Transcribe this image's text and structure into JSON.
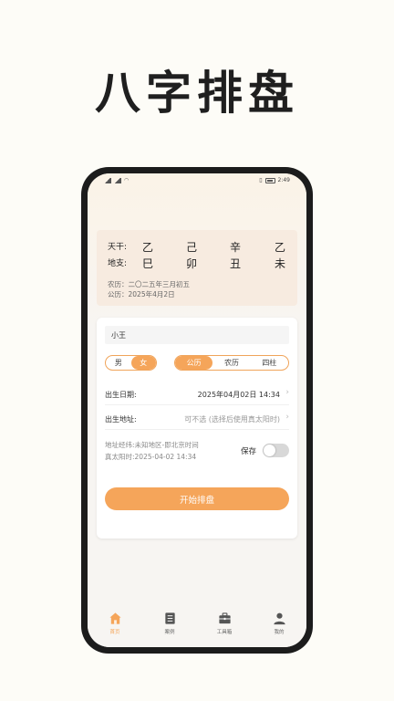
{
  "hero_title": "八字排盘",
  "status_bar": {
    "time": "2:49"
  },
  "bazi": {
    "tiangan_label": "天干:",
    "tiangan": [
      "乙",
      "己",
      "辛",
      "乙"
    ],
    "dizhi_label": "地支:",
    "dizhi": [
      "巳",
      "卯",
      "丑",
      "未"
    ],
    "lunar": "农历：二〇二五年三月初五",
    "solar": "公历：2025年4月2日"
  },
  "form": {
    "name_value": "小王",
    "gender": {
      "options": [
        "男",
        "女"
      ],
      "selected": "女"
    },
    "calendar": {
      "options": [
        "公历",
        "农历",
        "四柱"
      ],
      "selected": "公历"
    },
    "birth_date_label": "出生日期:",
    "birth_date_value": "2025年04月02日 14:34",
    "birth_place_label": "出生地址:",
    "birth_place_value": "可不选 (选择后使用真太阳时)",
    "geo_line1": "地址经纬:未知地区-即北京时间",
    "geo_line2": "真太阳时:2025-04-02 14:34",
    "save_label": "保存",
    "save_toggle": false,
    "start_button": "开始排盘"
  },
  "tabs": [
    {
      "label": "首页",
      "icon": "home-icon",
      "active": true
    },
    {
      "label": "案例",
      "icon": "list-icon",
      "active": false
    },
    {
      "label": "工具箱",
      "icon": "toolbox-icon",
      "active": false
    },
    {
      "label": "我的",
      "icon": "user-icon",
      "active": false
    }
  ],
  "colors": {
    "accent": "#f5a55a",
    "card_bg": "#f7ebe0",
    "phone_frame": "#1c1c1c"
  }
}
